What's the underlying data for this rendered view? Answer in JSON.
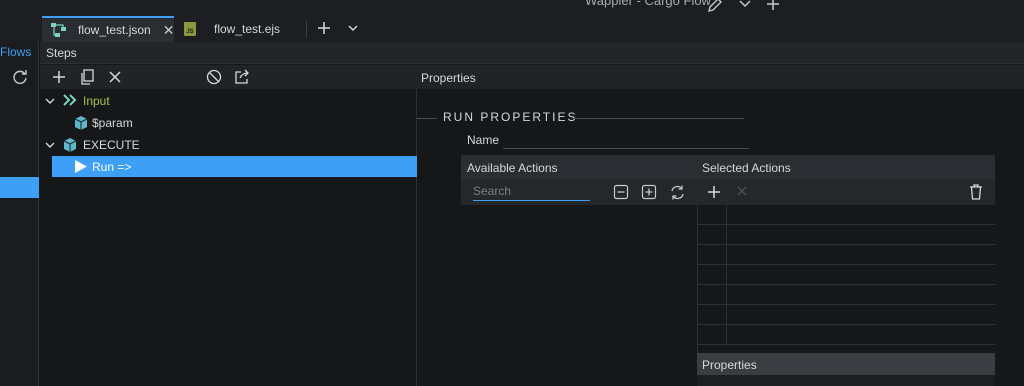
{
  "window": {
    "title": "Wappler - Cargo Flow"
  },
  "tabs": [
    {
      "label": "flow_test.json",
      "icon": "flow-icon",
      "active": true
    },
    {
      "label": "flow_test.ejs",
      "icon": "js-file-icon",
      "active": false
    }
  ],
  "sidebar": {
    "flows_label": "Flows"
  },
  "steps": {
    "header": "Steps",
    "tree": [
      {
        "label": "Input",
        "icon": "input-chevrons-icon",
        "expanded": true
      },
      {
        "label": "$param",
        "icon": "cube-icon"
      },
      {
        "label": "EXECUTE",
        "icon": "cube-icon",
        "expanded": true
      },
      {
        "label": "Run =>",
        "icon": "play-icon",
        "selected": true
      }
    ]
  },
  "properties": {
    "header": "Properties",
    "section_title": "RUN PROPERTIES",
    "name_label": "Name",
    "name_value": "",
    "available_actions": {
      "header": "Available Actions",
      "search_placeholder": "Search"
    },
    "selected_actions": {
      "header": "Selected Actions",
      "rows": 7
    },
    "sub_properties_header": "Properties"
  },
  "colors": {
    "accent": "#3d9ff5",
    "input_label": "#a6c24a",
    "background": "#151719"
  }
}
